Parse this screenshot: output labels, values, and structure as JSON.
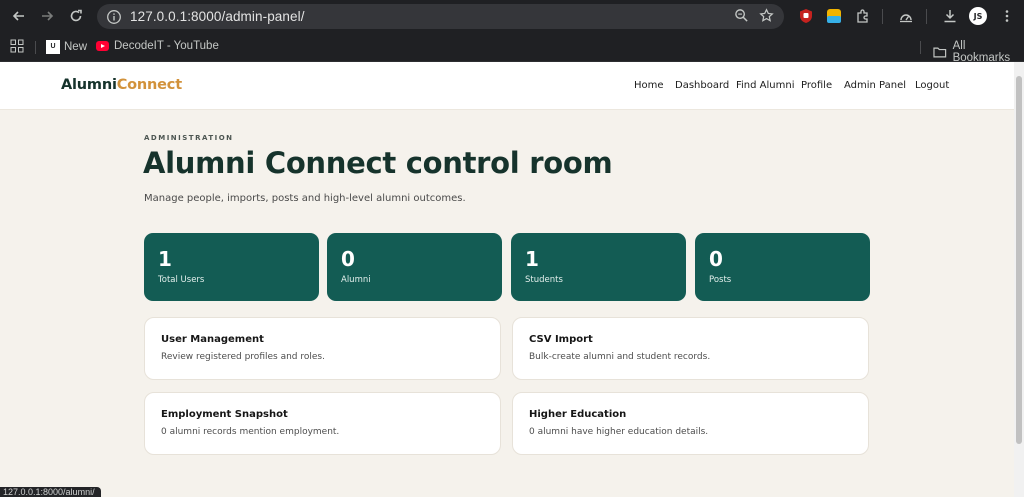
{
  "browser": {
    "url": "127.0.0.1:8000/admin-panel/",
    "bookmarks": [
      {
        "label": "New"
      },
      {
        "label": "DecodeIT - YouTube"
      }
    ],
    "all_bookmarks_label": "All Bookmarks",
    "profile_initials": "JS",
    "status_url": "127.0.0.1:8000/alumni/"
  },
  "site": {
    "logo_primary": "Alumni",
    "logo_accent": "Connect",
    "nav": [
      "Home",
      "Dashboard",
      "Find Alumni",
      "Profile",
      "Admin Panel",
      "Logout"
    ]
  },
  "hero": {
    "eyebrow": "ADMINISTRATION",
    "title": "Alumni Connect control room",
    "subtitle": "Manage people, imports, posts and high-level alumni outcomes."
  },
  "stats": [
    {
      "value": "1",
      "label": "Total Users"
    },
    {
      "value": "0",
      "label": "Alumni"
    },
    {
      "value": "1",
      "label": "Students"
    },
    {
      "value": "0",
      "label": "Posts"
    }
  ],
  "cards": [
    {
      "title": "User Management",
      "desc": "Review registered profiles and roles."
    },
    {
      "title": "CSV Import",
      "desc": "Bulk-create alumni and student records."
    },
    {
      "title": "Employment Snapshot",
      "desc": "0 alumni records mention employment."
    },
    {
      "title": "Higher Education",
      "desc": "0 alumni have higher education details."
    }
  ],
  "colors": {
    "brand_dark": "#16332c",
    "accent": "#d2923b",
    "stat_bg": "#135c54",
    "page_bg": "#f5f2ec"
  }
}
